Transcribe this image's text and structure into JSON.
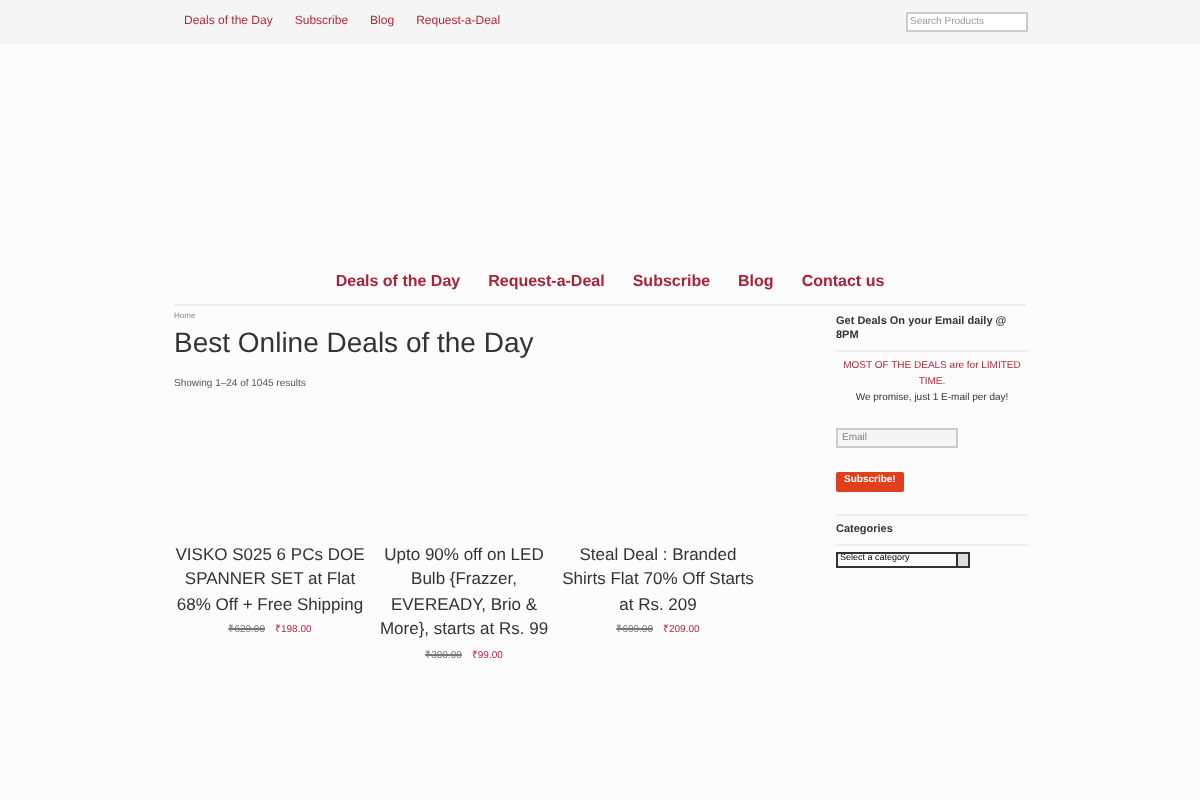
{
  "top_nav": {
    "items": [
      "Deals of the Day",
      "Subscribe",
      "Blog",
      "Request-a-Deal"
    ],
    "search": {
      "placeholder": "Search Products"
    }
  },
  "main_nav": {
    "items": [
      "Deals of the Day",
      "Request-a-Deal",
      "Subscribe",
      "Blog",
      "Contact us"
    ]
  },
  "breadcrumb": "Home",
  "page_title": "Best Online Deals of the Day",
  "result_count": "Showing 1–24 of 1045 results",
  "products": [
    {
      "title": "VISKO S025 6 PCs DOE SPANNER SET at Flat 68% Off + Free Shipping",
      "old_price": "₹620.00",
      "price": "₹198.00"
    },
    {
      "title": "Upto 90% off on LED Bulb {Frazzer, EVEREADY, Brio & More}, starts at Rs. 99",
      "old_price": "₹300.00",
      "price": "₹99.00"
    },
    {
      "title": "Steal Deal : Branded Shirts Flat 70% Off Starts at Rs. 209",
      "old_price": "₹699.00",
      "price": "₹209.00"
    }
  ],
  "sidebar": {
    "subscribe_title": "Get Deals On your Email daily @ 8PM",
    "notice": "MOST OF THE DEALS are for LIMITED TIME.",
    "promise": "We promise, just 1 E-mail per day!",
    "email": {
      "placeholder": "Email"
    },
    "button": "Subscribe!",
    "categories_title": "Categories",
    "category_select": "Select a category"
  }
}
